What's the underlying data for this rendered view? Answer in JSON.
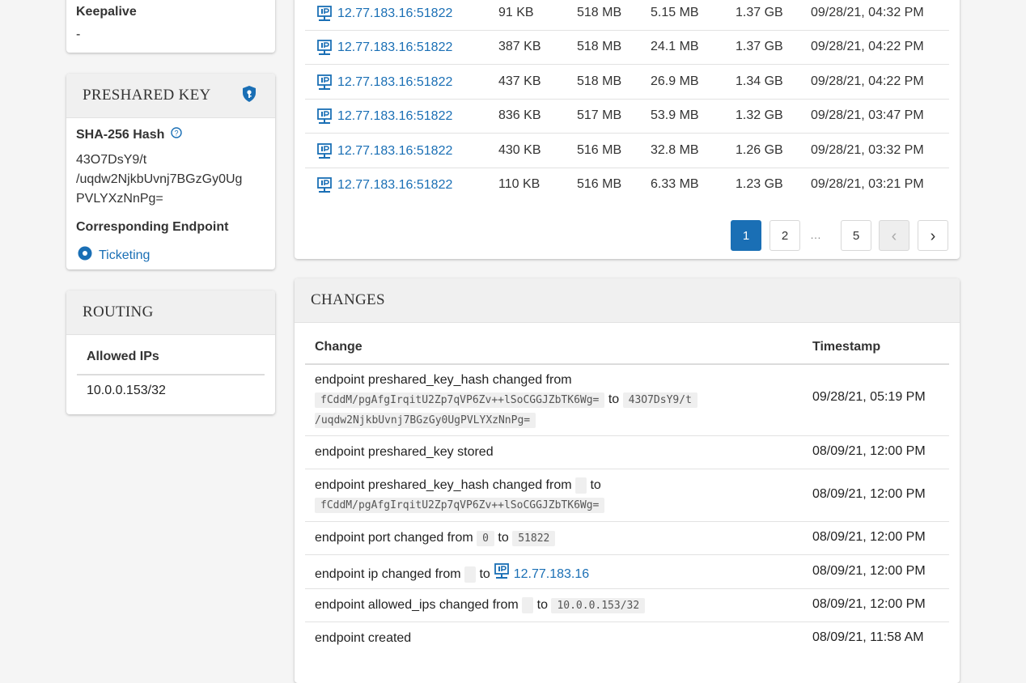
{
  "keepalive": {
    "label": "Keepalive",
    "value": "-"
  },
  "preshared_key": {
    "title": "PRESHARED KEY",
    "hash_label": "SHA-256 Hash",
    "hash_line1": "43O7DsY9/t",
    "hash_line2": "/uqdw2NjkbUvnj7BGzGy0Ug",
    "hash_line3": "PVLYXzNnPg=",
    "endpoint_label": "Corresponding Endpoint",
    "endpoint_value": "Ticketing"
  },
  "routing": {
    "title": "ROUTING",
    "allowed_ips_label": "Allowed IPs",
    "allowed_ips_value": "10.0.0.153/32"
  },
  "sessions": {
    "rows": [
      {
        "ip": "12.77.183.16:51822",
        "c2": "91 KB",
        "c3": "518 MB",
        "c4": "5.15 MB",
        "c5": "1.37 GB",
        "time": "09/28/21, 04:32 PM"
      },
      {
        "ip": "12.77.183.16:51822",
        "c2": "387 KB",
        "c3": "518 MB",
        "c4": "24.1 MB",
        "c5": "1.37 GB",
        "time": "09/28/21, 04:22 PM"
      },
      {
        "ip": "12.77.183.16:51822",
        "c2": "437 KB",
        "c3": "518 MB",
        "c4": "26.9 MB",
        "c5": "1.34 GB",
        "time": "09/28/21, 04:22 PM"
      },
      {
        "ip": "12.77.183.16:51822",
        "c2": "836 KB",
        "c3": "517 MB",
        "c4": "53.9 MB",
        "c5": "1.32 GB",
        "time": "09/28/21, 03:47 PM"
      },
      {
        "ip": "12.77.183.16:51822",
        "c2": "430 KB",
        "c3": "516 MB",
        "c4": "32.8 MB",
        "c5": "1.26 GB",
        "time": "09/28/21, 03:32 PM"
      },
      {
        "ip": "12.77.183.16:51822",
        "c2": "110 KB",
        "c3": "516 MB",
        "c4": "6.33 MB",
        "c5": "1.23 GB",
        "time": "09/28/21, 03:21 PM"
      }
    ],
    "pagination": {
      "p1": "1",
      "p2": "2",
      "ellipsis": "…",
      "p5": "5",
      "prev": "‹",
      "next": "›"
    }
  },
  "changes": {
    "title": "CHANGES",
    "col_change": "Change",
    "col_timestamp": "Timestamp",
    "r1": {
      "text": "endpoint preshared_key_hash changed from",
      "from": "fCddM/pgAfgIrqitU2Zp7qVP6Zv++lSoCGGJZbTK6Wg=",
      "to_word": "to",
      "to_line1": "43O7DsY9/t",
      "to_line2": "/uqdw2NjkbUvnj7BGzGy0UgPVLYXzNnPg=",
      "ts": "09/28/21, 05:19 PM"
    },
    "r2": {
      "text": "endpoint preshared_key stored",
      "ts": "08/09/21, 12:00 PM"
    },
    "r3": {
      "text": "endpoint preshared_key_hash changed from",
      "to_word": "to",
      "to_value": "fCddM/pgAfgIrqitU2Zp7qVP6Zv++lSoCGGJZbTK6Wg=",
      "ts": "08/09/21, 12:00 PM"
    },
    "r4": {
      "text": "endpoint port changed from",
      "from": "0",
      "to_word": "to",
      "to_value": "51822",
      "ts": "08/09/21, 12:00 PM"
    },
    "r5": {
      "text": "endpoint ip changed from",
      "to_word": "to",
      "to_value": "12.77.183.16",
      "ts": "08/09/21, 12:00 PM"
    },
    "r6": {
      "text": "endpoint allowed_ips changed from",
      "to_word": "to",
      "to_value": "10.0.0.153/32",
      "ts": "08/09/21, 12:00 PM"
    },
    "r7": {
      "text": "endpoint created",
      "ts": "08/09/21, 11:58 AM"
    }
  },
  "colors": {
    "accent": "#1a6fb5",
    "header_bg": "#f0f0f0"
  }
}
